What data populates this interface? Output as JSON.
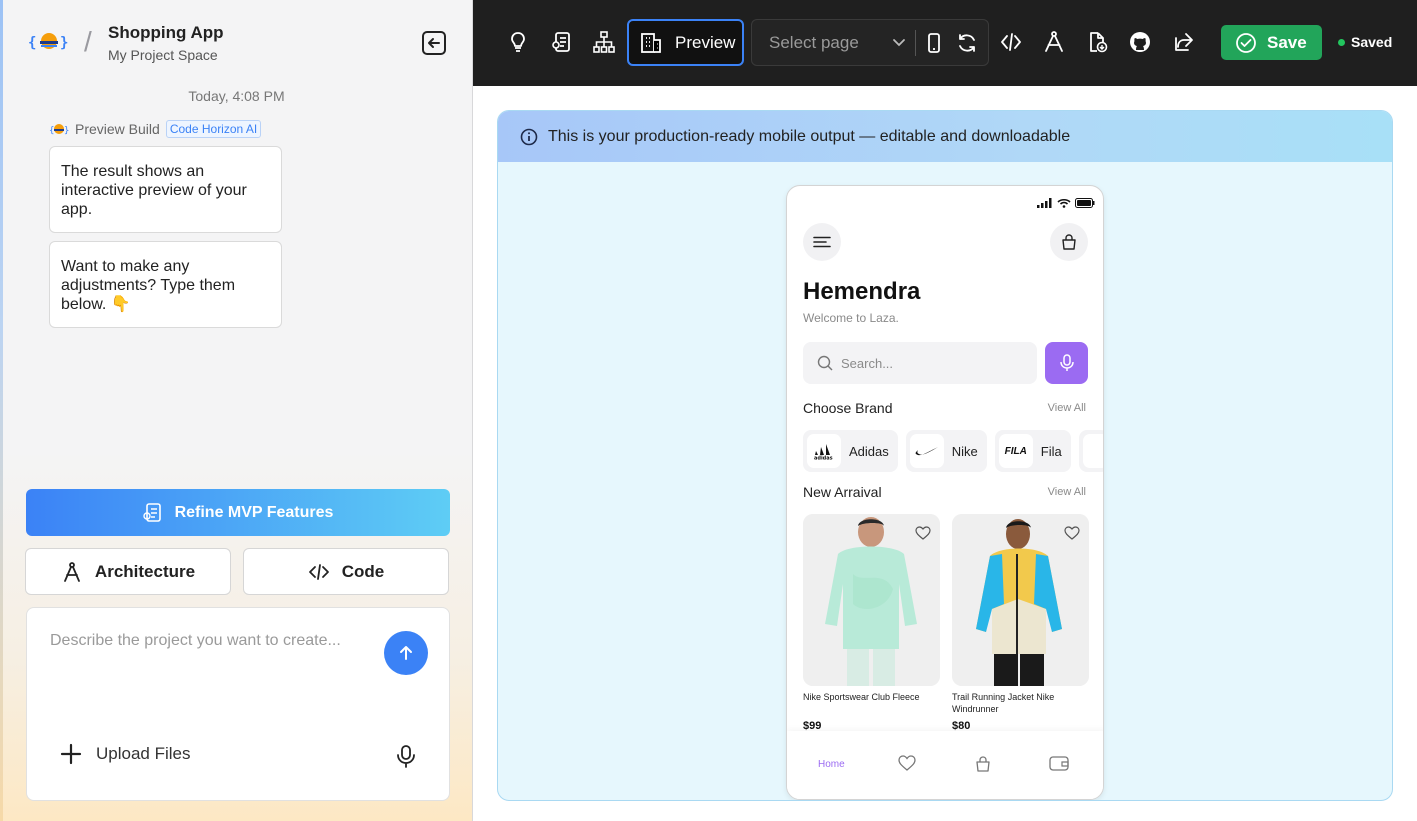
{
  "sidebar": {
    "app_title": "Shopping App",
    "project_space": "My Project Space",
    "timestamp": "Today, 4:08 PM",
    "bot_name": "Preview Build",
    "bot_badge": "Code Horizon AI",
    "messages": [
      "The result shows an interactive preview of your app.",
      "Want to make any adjustments? Type them below. 👇"
    ],
    "refine_label": "Refine MVP Features",
    "architecture_label": "Architecture",
    "code_label": "Code",
    "composer_placeholder": "Describe the project you want to create...",
    "upload_label": "Upload Files"
  },
  "toolbar": {
    "preview_label": "Preview",
    "page_select_placeholder": "Select page",
    "save_label": "Save",
    "saved_label": "Saved"
  },
  "banner": {
    "text": "This is your production-ready mobile output — editable and downloadable"
  },
  "phone": {
    "user_name": "Hemendra",
    "welcome": "Welcome to Laza.",
    "search_placeholder": "Search...",
    "choose_brand": "Choose Brand",
    "view_all_1": "View All",
    "brands": [
      {
        "name": "Adidas",
        "logo": "adidas"
      },
      {
        "name": "Nike",
        "logo": "NIKE"
      },
      {
        "name": "Fila",
        "logo": "FILA"
      }
    ],
    "new_arrival": "New Arraival",
    "view_all_2": "View All",
    "products": [
      {
        "name": "Nike Sportswear Club Fleece",
        "price": "$99"
      },
      {
        "name": "Trail Running Jacket Nike Windrunner",
        "price": "$80"
      }
    ],
    "tabs": {
      "home": "Home"
    }
  },
  "colors": {
    "accent_blue": "#3b82f6",
    "save_green": "#22a55a",
    "mic_purple": "#9b6bf2",
    "toolbar_bg": "#1f1f1f"
  }
}
